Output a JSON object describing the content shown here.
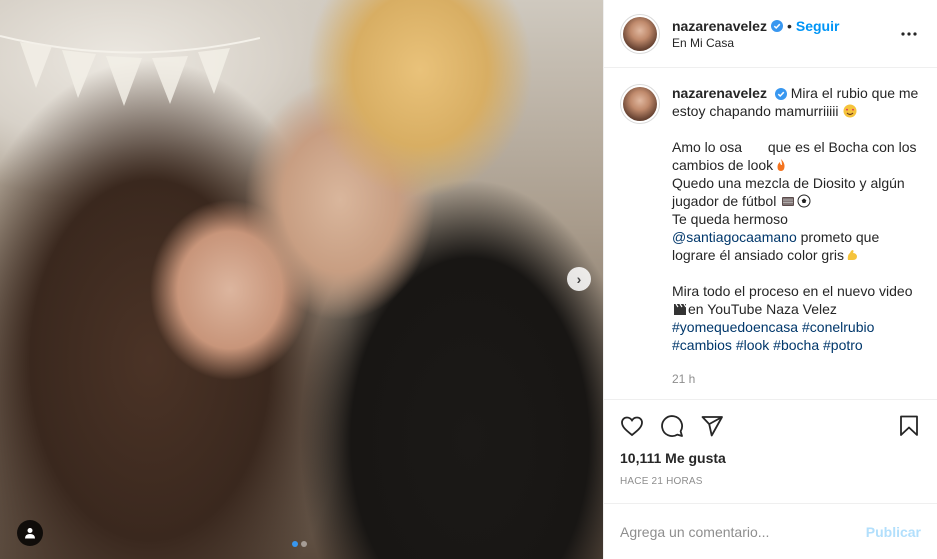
{
  "header": {
    "username": "nazarenavelez",
    "follow_label": "Seguir",
    "separator": "•",
    "location": "En Mi Casa",
    "more_icon": "more-options-icon"
  },
  "caption": {
    "username": "nazarenavelez",
    "line1": "Mira el rubio que me estoy chapando mamurriiiii",
    "line2a": "Amo lo osa",
    "line2b": "que es el Bocha con los cambios de look",
    "line3": "Quedo una mezcla de Diosito y algún jugador de fútbol",
    "line4": "Te queda hermoso",
    "mention": "@santiagocaamano",
    "line5": "prometo que lograre él ansiado color gris",
    "line6": "Mira todo el proceso en el nuevo video",
    "line6b": "en YouTube Naza Velez",
    "hashtags": [
      "#yomequedoencasa",
      "#conelrubio",
      "#cambios",
      "#look",
      "#bocha",
      "#potro"
    ],
    "age": "21 h"
  },
  "actions": {
    "likes": "10,111 Me gusta",
    "posted": "HACE 21 HORAS"
  },
  "comment": {
    "placeholder": "Agrega un comentario...",
    "post_label": "Publicar"
  },
  "media": {
    "slide_count": 2,
    "active_slide": 1
  },
  "colors": {
    "accent": "#0095f6",
    "link": "#00376b",
    "muted": "#8e8e8e",
    "post_disabled": "#b2dffc"
  }
}
